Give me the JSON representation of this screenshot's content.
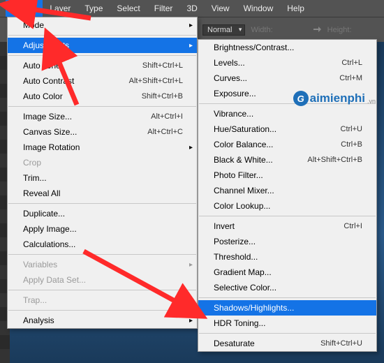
{
  "menubar": {
    "items": [
      "Image",
      "Layer",
      "Type",
      "Select",
      "Filter",
      "3D",
      "View",
      "Window",
      "Help"
    ],
    "active_index": 0
  },
  "options_bar": {
    "mode_value": "Normal",
    "width_label": "Width:",
    "height_label": "Height:"
  },
  "menu1": [
    {
      "type": "item",
      "label": "Mode",
      "submenu": true
    },
    {
      "type": "sep"
    },
    {
      "type": "item",
      "label": "Adjustments",
      "submenu": true,
      "highlight": true
    },
    {
      "type": "sep"
    },
    {
      "type": "item",
      "label": "Auto Tone",
      "shortcut": "Shift+Ctrl+L"
    },
    {
      "type": "item",
      "label": "Auto Contrast",
      "shortcut": "Alt+Shift+Ctrl+L"
    },
    {
      "type": "item",
      "label": "Auto Color",
      "shortcut": "Shift+Ctrl+B"
    },
    {
      "type": "sep"
    },
    {
      "type": "item",
      "label": "Image Size...",
      "shortcut": "Alt+Ctrl+I"
    },
    {
      "type": "item",
      "label": "Canvas Size...",
      "shortcut": "Alt+Ctrl+C"
    },
    {
      "type": "item",
      "label": "Image Rotation",
      "submenu": true
    },
    {
      "type": "item",
      "label": "Crop",
      "disabled": true
    },
    {
      "type": "item",
      "label": "Trim..."
    },
    {
      "type": "item",
      "label": "Reveal All"
    },
    {
      "type": "sep"
    },
    {
      "type": "item",
      "label": "Duplicate..."
    },
    {
      "type": "item",
      "label": "Apply Image..."
    },
    {
      "type": "item",
      "label": "Calculations..."
    },
    {
      "type": "sep"
    },
    {
      "type": "item",
      "label": "Variables",
      "submenu": true,
      "disabled": true
    },
    {
      "type": "item",
      "label": "Apply Data Set...",
      "disabled": true
    },
    {
      "type": "sep"
    },
    {
      "type": "item",
      "label": "Trap...",
      "disabled": true
    },
    {
      "type": "sep"
    },
    {
      "type": "item",
      "label": "Analysis",
      "submenu": true
    }
  ],
  "menu2": [
    {
      "type": "item",
      "label": "Brightness/Contrast..."
    },
    {
      "type": "item",
      "label": "Levels...",
      "shortcut": "Ctrl+L"
    },
    {
      "type": "item",
      "label": "Curves...",
      "shortcut": "Ctrl+M"
    },
    {
      "type": "item",
      "label": "Exposure..."
    },
    {
      "type": "sep"
    },
    {
      "type": "item",
      "label": "Vibrance..."
    },
    {
      "type": "item",
      "label": "Hue/Saturation...",
      "shortcut": "Ctrl+U"
    },
    {
      "type": "item",
      "label": "Color Balance...",
      "shortcut": "Ctrl+B"
    },
    {
      "type": "item",
      "label": "Black & White...",
      "shortcut": "Alt+Shift+Ctrl+B"
    },
    {
      "type": "item",
      "label": "Photo Filter..."
    },
    {
      "type": "item",
      "label": "Channel Mixer..."
    },
    {
      "type": "item",
      "label": "Color Lookup..."
    },
    {
      "type": "sep"
    },
    {
      "type": "item",
      "label": "Invert",
      "shortcut": "Ctrl+I"
    },
    {
      "type": "item",
      "label": "Posterize..."
    },
    {
      "type": "item",
      "label": "Threshold..."
    },
    {
      "type": "item",
      "label": "Gradient Map..."
    },
    {
      "type": "item",
      "label": "Selective Color..."
    },
    {
      "type": "sep"
    },
    {
      "type": "item",
      "label": "Shadows/Highlights...",
      "highlight": true
    },
    {
      "type": "item",
      "label": "HDR Toning..."
    },
    {
      "type": "sep"
    },
    {
      "type": "item",
      "label": "Desaturate",
      "shortcut": "Shift+Ctrl+U"
    }
  ],
  "watermark": {
    "brand": "aimienphi",
    "suffix": ".vn"
  },
  "arrow_color": "#ff2a2a"
}
